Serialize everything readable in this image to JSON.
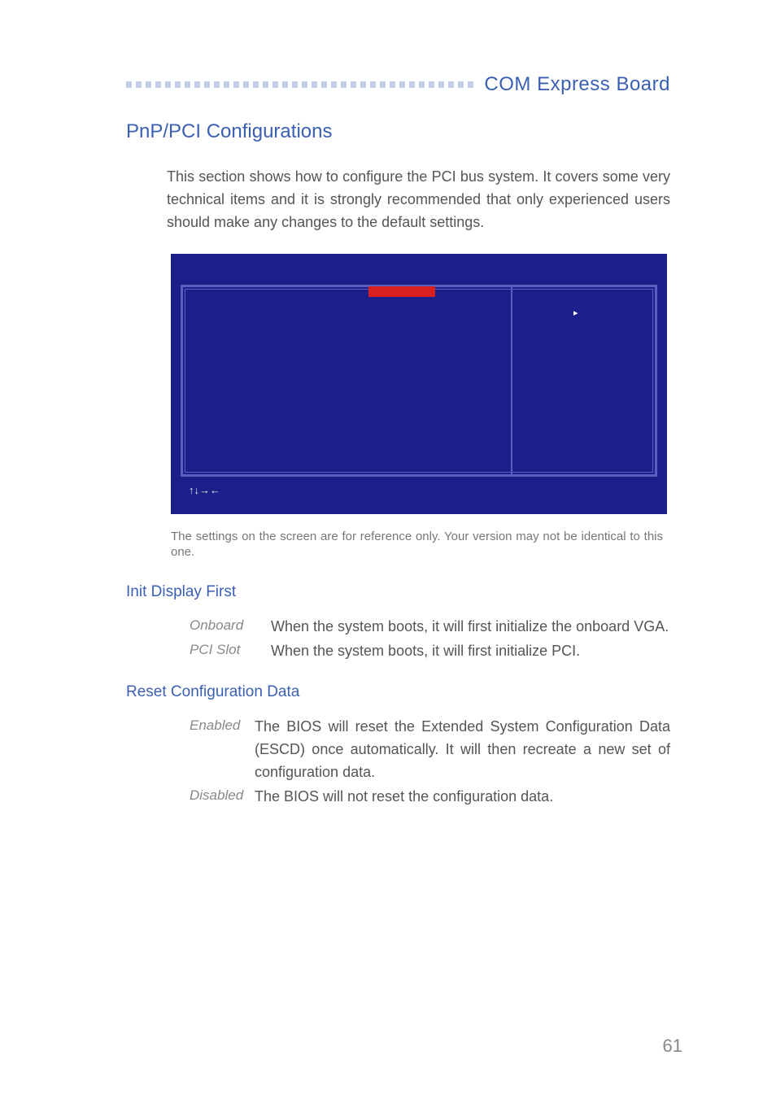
{
  "header": {
    "board_title": "COM Express Board"
  },
  "section": {
    "title": "PnP/PCI Configurations",
    "intro": "This section shows how to configure the PCI bus system. It covers some very technical items and it is strongly recommended that only experienced users should make any changes to the default settings."
  },
  "bios": {
    "keys": "↑↓→←",
    "arrow": "▸"
  },
  "caption": "The settings on the screen are for reference only. Your version may not be identical to this one.",
  "sub1": {
    "title": "Init Display First",
    "options": [
      {
        "label": "Onboard",
        "text": "When the system boots, it will first initialize the onboard VGA."
      },
      {
        "label": "PCI Slot",
        "text": "When the system boots, it will first initialize PCI."
      }
    ]
  },
  "sub2": {
    "title": "Reset Configuration Data",
    "options": [
      {
        "label": "Enabled",
        "text": "The BIOS will reset the Extended System Configuration Data (ESCD) once automatically. It will then recreate a new set of configuration data."
      },
      {
        "label": "Disabled",
        "text": "The BIOS will not reset the configuration data."
      }
    ]
  },
  "page_number": "61"
}
